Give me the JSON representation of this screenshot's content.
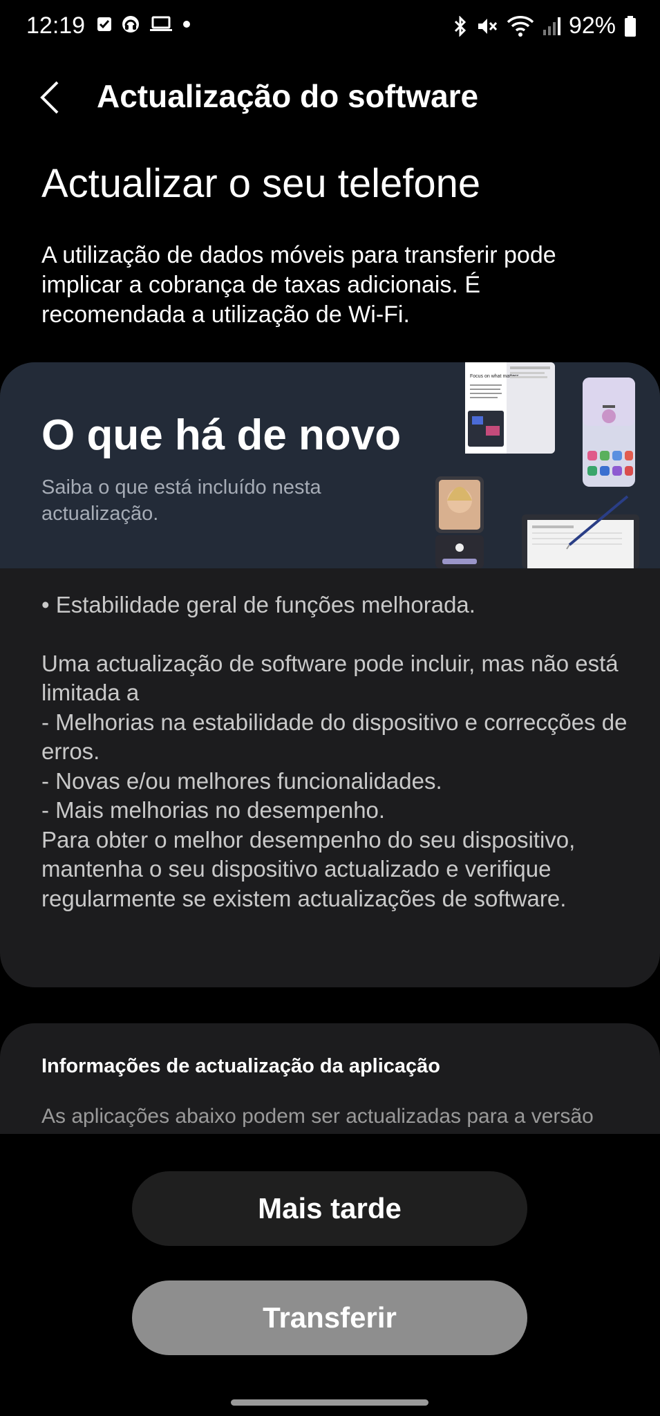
{
  "status_bar": {
    "time": "12:19",
    "left_icons": [
      "checkbox-icon",
      "headset-icon",
      "laptop-icon",
      "dot-icon"
    ],
    "right_icons": [
      "bluetooth-icon",
      "mute-icon",
      "wifi-icon",
      "signal-icon",
      "battery-icon"
    ],
    "battery_percent": "92%"
  },
  "app_bar": {
    "back_icon": "chevron-left-icon",
    "title": "Actualização do software"
  },
  "header": {
    "heading": "Actualizar o seu telefone",
    "description": "A utilização de dados móveis para transferir pode implicar a cobrança de taxas adicionais. É recomendada a utilização de Wi-Fi."
  },
  "whats_new": {
    "title": "O que há de novo",
    "subtitle": "Saiba o que está incluído nesta actualização.",
    "banner_phone_text": "Focus on what matters",
    "notes": [
      "• Estabilidade geral de funções melhorada.",
      "Uma actualização de software pode incluir, mas não está limitada a\n - Melhorias na estabilidade do dispositivo e correcções de erros.\n - Novas e/ou melhores funcionalidades.\n - Mais melhorias no desempenho.\nPara obter o melhor desempenho do seu dispositivo, mantenha o seu dispositivo actualizado e verifique regularmente se existem actualizações de software."
    ]
  },
  "app_info": {
    "title": "Informações de actualização da aplicação",
    "text": "As aplicações abaixo podem ser actualizadas para a versão mais recente após a actualização do software."
  },
  "buttons": {
    "later": "Mais tarde",
    "download": "Transferir"
  }
}
